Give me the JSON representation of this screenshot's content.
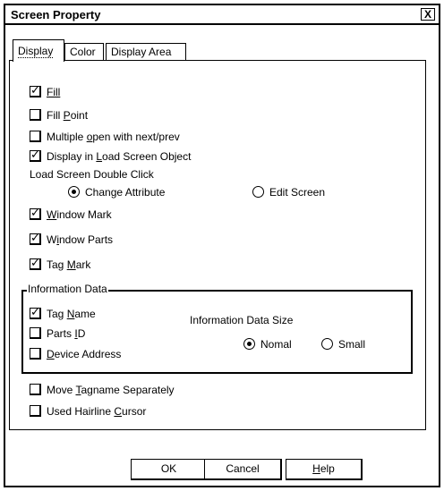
{
  "window": {
    "title": "Screen Property",
    "close_glyph": "X"
  },
  "tabs": [
    {
      "label": "Display"
    },
    {
      "label": "Color"
    },
    {
      "label": "Display Area"
    }
  ],
  "options": {
    "fill": {
      "label": "Fill",
      "checked": true
    },
    "fill_point": {
      "pre": "Fill ",
      "key": "P",
      "post": "oint",
      "checked": false
    },
    "multiple_open": {
      "pre": "Multiple ",
      "key": "o",
      "post": "pen with next/prev",
      "checked": false
    },
    "display_load": {
      "pre": "Display in ",
      "key": "L",
      "post": "oad Screen Object",
      "checked": true
    },
    "double_click_label": "Load Screen Double Click",
    "change_attribute": {
      "label": "Change Attribute",
      "selected": true
    },
    "edit_screen": {
      "label": "Edit Screen",
      "selected": false
    },
    "window_mark": {
      "key": "W",
      "post": "indow Mark",
      "checked": true
    },
    "window_parts": {
      "pre": "W",
      "key": "i",
      "post": "ndow Parts",
      "checked": true
    },
    "tag_mark": {
      "pre": "Tag ",
      "key": "M",
      "post": "ark",
      "checked": true
    }
  },
  "information_data": {
    "legend": "Information Data",
    "tag_name": {
      "pre": "Tag ",
      "key": "N",
      "post": "ame",
      "checked": true
    },
    "parts_id": {
      "pre": "Parts ",
      "key": "I",
      "post": "D",
      "checked": false
    },
    "device_address": {
      "key": "D",
      "post": "evice Address",
      "checked": false
    },
    "size_label": "Information Data Size",
    "nomal": {
      "label": "Nomal",
      "selected": true
    },
    "small": {
      "label": "Small",
      "selected": false
    }
  },
  "extra": {
    "move_tagname": {
      "pre": "Move ",
      "key": "T",
      "post": "agname Separately",
      "checked": false
    },
    "hairline": {
      "pre": "Used Hairline ",
      "key": "C",
      "post": "ursor",
      "checked": false
    }
  },
  "buttons": {
    "ok": "OK",
    "cancel": "Cancel",
    "help_key": "H",
    "help_post": "elp"
  }
}
